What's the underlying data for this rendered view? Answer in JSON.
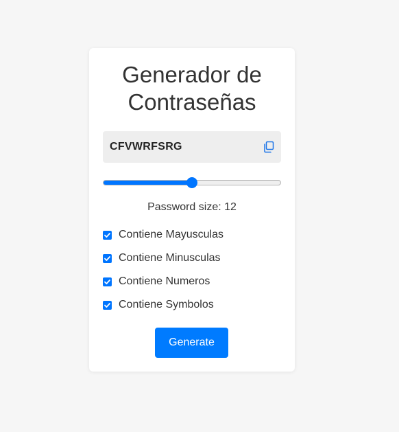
{
  "title": "Generador de Contraseñas",
  "title_lines": [
    "Generador de",
    "Contraseñas"
  ],
  "password": "CFVWRFSRG",
  "copy_icon": "copy-icon",
  "slider": {
    "value": 12,
    "min": 4,
    "max": 20
  },
  "size_label": "Password size: ",
  "size_value": "12",
  "options": [
    {
      "label": "Contiene Mayusculas",
      "checked": true
    },
    {
      "label": "Contiene Minusculas",
      "checked": true
    },
    {
      "label": "Contiene Numeros",
      "checked": true
    },
    {
      "label": "Contiene Symbolos",
      "checked": true
    }
  ],
  "generate_label": "Generate",
  "colors": {
    "accent": "#007bff",
    "slider_accent": "#0075ff",
    "background": "#f6f6f6",
    "card": "#ffffff",
    "password_box": "#eeeeee"
  }
}
